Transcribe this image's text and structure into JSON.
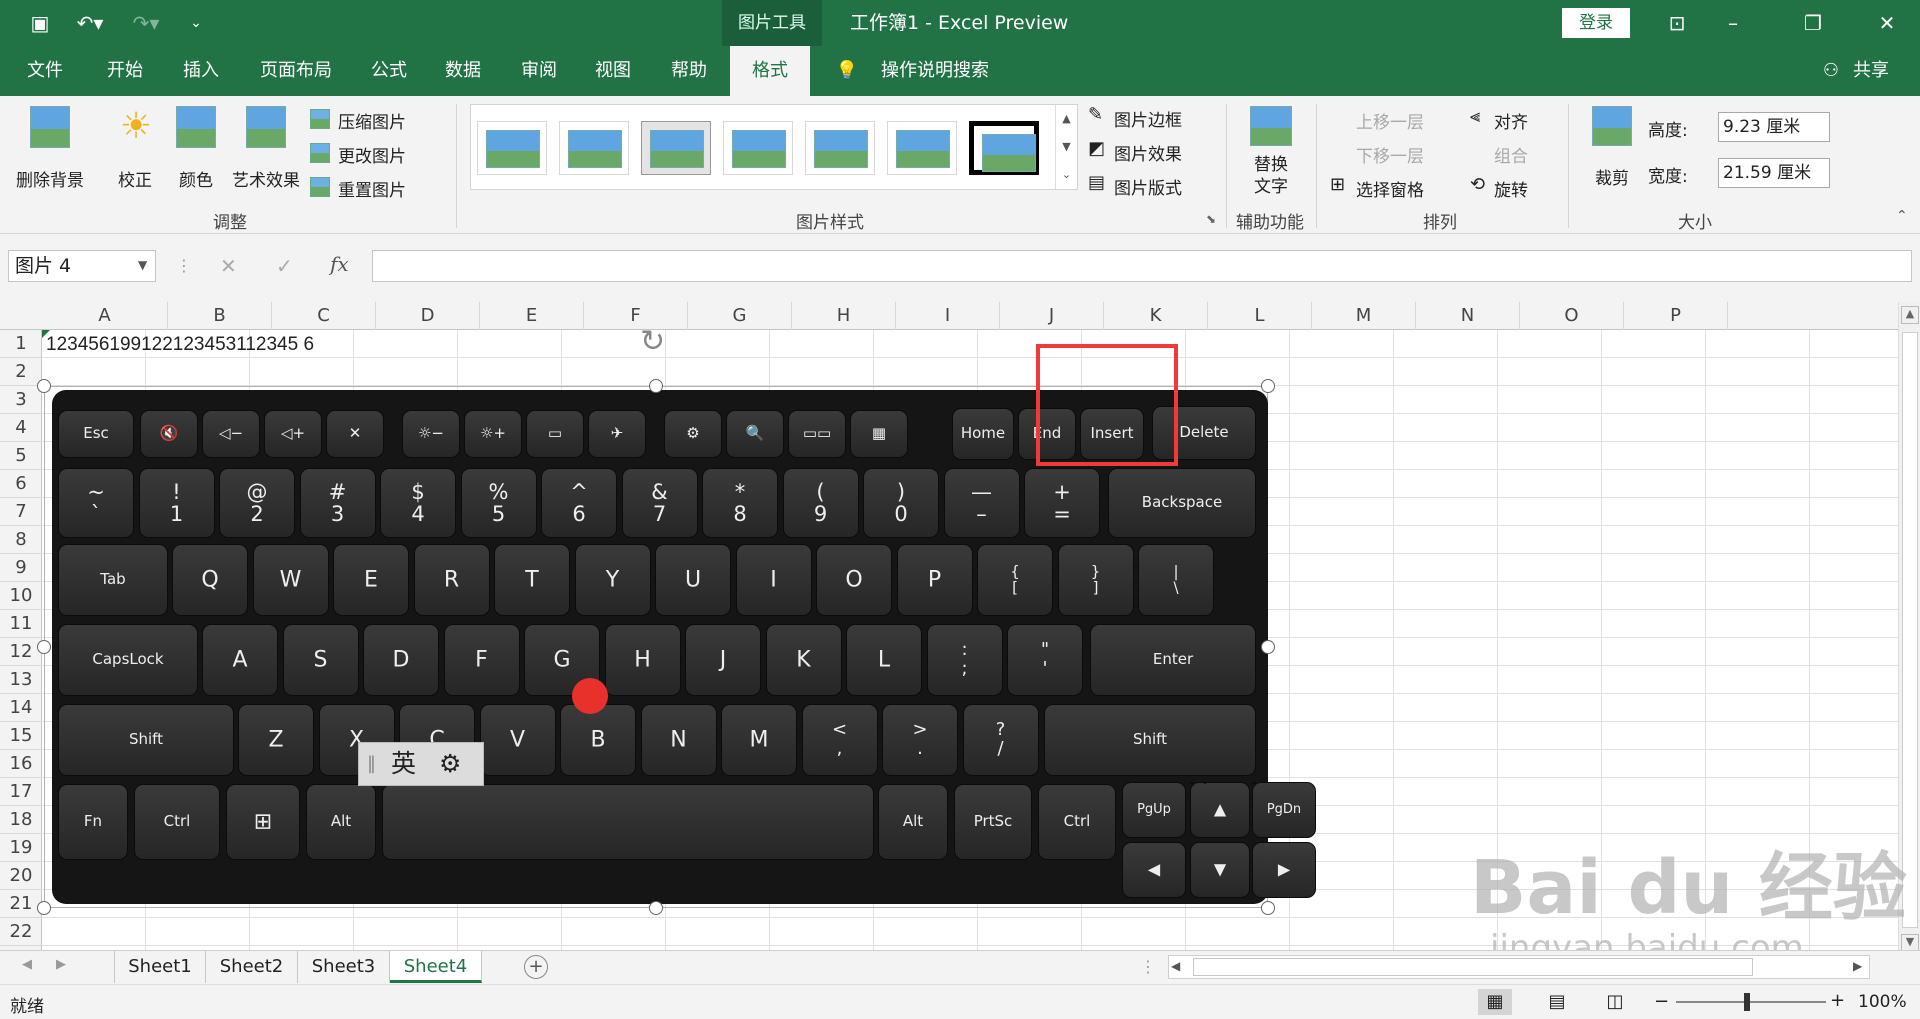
{
  "titlebar": {
    "context_tab": "图片工具",
    "title": "工作簿1  -  Excel Preview",
    "login": "登录"
  },
  "tabs": [
    "文件",
    "开始",
    "插入",
    "页面布局",
    "公式",
    "数据",
    "审阅",
    "视图",
    "帮助",
    "格式"
  ],
  "active_tab": "格式",
  "tell_me": "操作说明搜索",
  "share": "共享",
  "ribbon": {
    "adjust": {
      "remove_bg": "删除背景",
      "correct": "校正",
      "color": "颜色",
      "artistic": "艺术效果",
      "compress": "压缩图片",
      "change": "更改图片",
      "reset": "重置图片",
      "group": "调整"
    },
    "styles": {
      "border": "图片边框",
      "effects": "图片效果",
      "layout": "图片版式",
      "group": "图片样式"
    },
    "access": {
      "alt_text": "替换\n文字",
      "group": "辅助功能"
    },
    "arrange": {
      "forward": "上移一层",
      "backward": "下移一层",
      "selection": "选择窗格",
      "align": "对齐",
      "group_btn": "组合",
      "rotate": "旋转",
      "group": "排列"
    },
    "size": {
      "crop": "裁剪",
      "height_label": "高度:",
      "height_value": "9.23 厘米",
      "width_label": "宽度:",
      "width_value": "21.59 厘米",
      "group": "大小"
    }
  },
  "namebox": "图片 4",
  "fx": "fx",
  "columns": [
    "A",
    "B",
    "C",
    "D",
    "E",
    "F",
    "G",
    "H",
    "I",
    "J",
    "K",
    "L",
    "M",
    "N",
    "O",
    "P"
  ],
  "rows": [
    "1",
    "2",
    "3",
    "4",
    "5",
    "6",
    "7",
    "8",
    "9",
    "10",
    "11",
    "12",
    "13",
    "14",
    "15",
    "16",
    "17",
    "18",
    "19",
    "20",
    "21",
    "22"
  ],
  "cell_a1": "123456199122123453112345 6",
  "sheets": [
    "Sheet1",
    "Sheet2",
    "Sheet3",
    "Sheet4"
  ],
  "active_sheet": "Sheet4",
  "status": {
    "ready": "就绪",
    "zoom": "100%"
  },
  "ime": {
    "lang": "英"
  },
  "watermark": {
    "brand": "Bai du 经验",
    "url": "jingyan.baidu.com"
  },
  "keyboard": {
    "row0": [
      "Esc",
      "",
      "",
      "",
      "",
      "",
      "",
      "",
      "",
      "",
      "",
      "",
      "",
      "Home",
      "End",
      "Insert",
      "Delete"
    ],
    "row1": [
      "~\n`",
      "!\n1",
      "@\n2",
      "#\n3",
      "$\n4",
      "%\n5",
      "^\n6",
      "&\n7",
      "*\n8",
      "(\n9",
      ")\n0",
      "—\n–",
      "+\n=",
      "Backspace"
    ],
    "row2": [
      "Tab",
      "Q",
      "W",
      "E",
      "R",
      "T",
      "Y",
      "U",
      "I",
      "O",
      "P",
      "{\n[",
      "}\n]",
      "|\n\\"
    ],
    "row3": [
      "CapsLock",
      "A",
      "S",
      "D",
      "F",
      "G",
      "H",
      "J",
      "K",
      "L",
      ":\n;",
      "\"\n'",
      "Enter"
    ],
    "row4": [
      "Shift",
      "Z",
      "X",
      "C",
      "V",
      "B",
      "N",
      "M",
      "<\n,",
      ">\n.",
      "?\n/",
      "Shift"
    ],
    "row5": [
      "Fn",
      "Ctrl",
      "⊞",
      "Alt",
      "",
      "Alt",
      "PrtSc",
      "Ctrl",
      "PgUp",
      "▲",
      "PgDn"
    ],
    "row6": [
      "◀",
      "▼",
      "▶"
    ]
  },
  "highlight_keys": [
    "End",
    "Insert"
  ],
  "colors": {
    "excel_green": "#217346",
    "highlight": "#f0393b",
    "trackpoint": "#e9312b"
  }
}
